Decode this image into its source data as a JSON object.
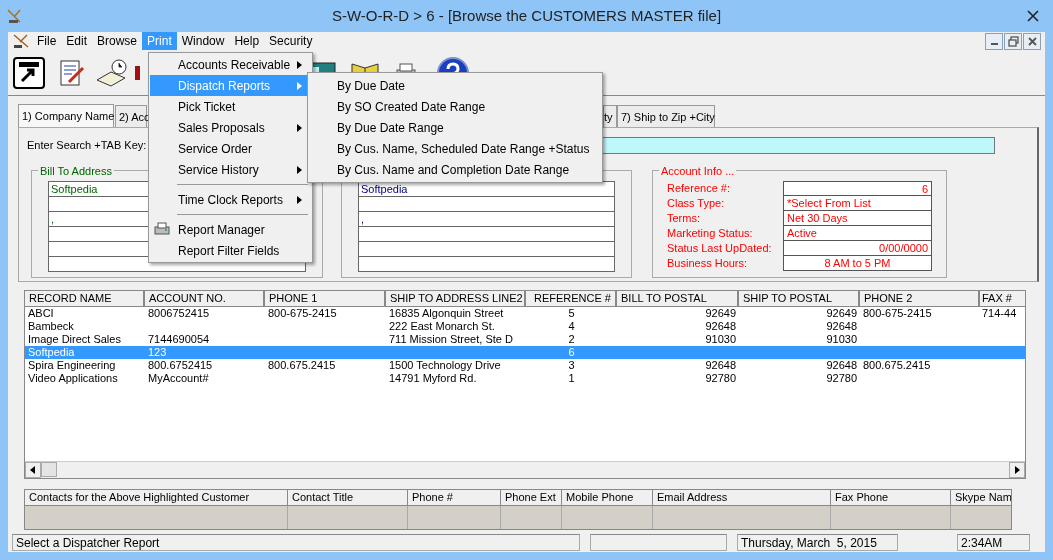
{
  "window": {
    "title": "S-W-O-R-D > 6 - [Browse the CUSTOMERS MASTER file]"
  },
  "menu_bar": [
    {
      "label": "File",
      "selected": false
    },
    {
      "label": "Edit",
      "selected": false
    },
    {
      "label": "Browse",
      "selected": false
    },
    {
      "label": "Print",
      "selected": true
    },
    {
      "label": "Window",
      "selected": false
    },
    {
      "label": "Help",
      "selected": false
    },
    {
      "label": "Security",
      "selected": false
    }
  ],
  "print_menu": [
    {
      "label": "Accounts Receivable",
      "submenu": true,
      "selected": false
    },
    {
      "label": "Dispatch Reports",
      "submenu": true,
      "selected": true
    },
    {
      "label": "Pick Ticket",
      "submenu": false,
      "selected": false
    },
    {
      "label": "Sales Proposals",
      "submenu": true,
      "selected": false
    },
    {
      "label": "Service Order",
      "submenu": false,
      "selected": false
    },
    {
      "label": "Service History",
      "submenu": true,
      "selected": false
    },
    {
      "label": "Time Clock Reports",
      "submenu": true,
      "selected": false,
      "separator_before": true
    },
    {
      "label": "Report Manager",
      "submenu": false,
      "selected": false,
      "separator_before": true,
      "kind": "icon"
    },
    {
      "label": "Report Filter Fields",
      "submenu": false,
      "selected": false
    }
  ],
  "dispatch_submenu": [
    {
      "label": "By Due Date"
    },
    {
      "label": "By SO Created Date Range"
    },
    {
      "label": "By Due Date Range"
    },
    {
      "label": "By Cus. Name, Scheduled Date Range +Status"
    },
    {
      "label": "By Cus. Name and Completion Date Range"
    }
  ],
  "tabs": [
    {
      "label": "1) Company Name",
      "selected": true
    },
    {
      "label": "2) Acc",
      "selected": false
    },
    {
      "label": "ty",
      "selected": false
    },
    {
      "label": "7) Ship to Zip +City",
      "selected": false
    }
  ],
  "search": {
    "label": "Enter Search +TAB Key:"
  },
  "bill_to": {
    "title": "Bill To Address",
    "fields": [
      "Softpedia",
      ","
    ]
  },
  "ship_to": {
    "fields": [
      "Softpedia",
      ","
    ]
  },
  "account_info": {
    "title": "Account Info ...",
    "rows": [
      {
        "label": "Reference #:",
        "value": "6"
      },
      {
        "label": "Class Type:",
        "value": "*Select From List"
      },
      {
        "label": "Terms:",
        "value": "Net 30 Days"
      },
      {
        "label": "Marketing Status:",
        "value": "Active"
      },
      {
        "label": "Status Last UpDated:",
        "value": "0/00/0000"
      },
      {
        "label": "Business Hours:",
        "value": "8 AM to 5 PM"
      }
    ]
  },
  "customers_table": {
    "columns": [
      "RECORD NAME",
      "ACCOUNT NO.",
      "PHONE 1",
      "SHIP TO ADDRESS LINE2",
      "REFERENCE #",
      "BILL TO POSTAL",
      "SHIP TO POSTAL",
      "PHONE 2",
      "FAX #"
    ],
    "rows": [
      {
        "selected": false,
        "cells": [
          "ABCI",
          "8006752415",
          "800-675-2415",
          "16835 Algonquin Street",
          "5",
          "92649",
          "92649",
          "800-675-2415",
          "714-44"
        ]
      },
      {
        "selected": false,
        "cells": [
          "Bambeck",
          "",
          "",
          "222 East Monarch St.",
          "4",
          "92648",
          "92648",
          "",
          ""
        ]
      },
      {
        "selected": false,
        "cells": [
          "Image Direct Sales",
          "7144690054",
          "",
          "711 Mission Street, Ste D",
          "2",
          "91030",
          "91030",
          "",
          ""
        ]
      },
      {
        "selected": true,
        "cells": [
          "Softpedia",
          "123",
          "",
          "",
          "6",
          "",
          "",
          "",
          ""
        ]
      },
      {
        "selected": false,
        "cells": [
          "Spira Engineering",
          "800.6752415",
          "800.675.2415",
          "1500 Technology Drive",
          "3",
          "92648",
          "92648",
          "800.675.2415",
          ""
        ]
      },
      {
        "selected": false,
        "cells": [
          "Video Applications",
          "MyAccount#",
          "",
          "14791 Myford Rd.",
          "1",
          "92780",
          "92780",
          "",
          ""
        ]
      }
    ]
  },
  "contacts_table": {
    "columns": [
      "Contacts for the Above Highlighted Customer",
      "Contact Title",
      "Phone #",
      "Phone Ext",
      "Mobile Phone",
      "Email Address",
      "Fax Phone",
      "Skype Nam"
    ]
  },
  "status_bar": {
    "message": "Select a Dispatcher Report",
    "date": "Thursday, March  5, 2015",
    "time": "2:34AM"
  }
}
